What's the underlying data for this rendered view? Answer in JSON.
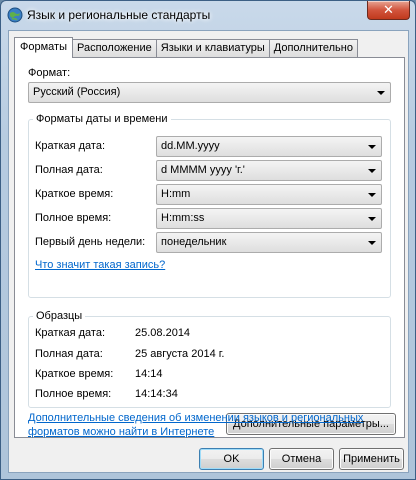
{
  "window": {
    "title": "Язык и региональные стандарты",
    "close_label": "✕"
  },
  "tabs": [
    {
      "label": "Форматы"
    },
    {
      "label": "Расположение"
    },
    {
      "label": "Языки и клавиатуры"
    },
    {
      "label": "Дополнительно"
    }
  ],
  "format": {
    "label": "Формат:",
    "value": "Русский (Россия)"
  },
  "datetime_group": {
    "title": "Форматы даты и времени",
    "rows": [
      {
        "label": "Краткая дата:",
        "value": "dd.MM.yyyy"
      },
      {
        "label": "Полная дата:",
        "value": "d MMMM yyyy 'г.'"
      },
      {
        "label": "Краткое время:",
        "value": "H:mm"
      },
      {
        "label": "Полное время:",
        "value": "H:mm:ss"
      },
      {
        "label": "Первый день недели:",
        "value": "понедельник"
      }
    ],
    "help_link": "Что значит такая запись?"
  },
  "samples_group": {
    "title": "Образцы",
    "rows": [
      {
        "label": "Краткая дата:",
        "value": "25.08.2014"
      },
      {
        "label": "Полная дата:",
        "value": "25 августа 2014 г."
      },
      {
        "label": "Краткое время:",
        "value": "14:14"
      },
      {
        "label": "Полное время:",
        "value": "14:14:34"
      }
    ]
  },
  "additional_button": "Дополнительные параметры...",
  "bottom_link_line1": "Дополнительные сведения об изменении языков и региональных",
  "bottom_link_line2": "форматов можно найти в Интернете",
  "buttons": {
    "ok": "OK",
    "cancel": "Отмена",
    "apply": "Применить"
  },
  "colors": {
    "link": "#0066cc",
    "close_button": "#c9452a"
  }
}
